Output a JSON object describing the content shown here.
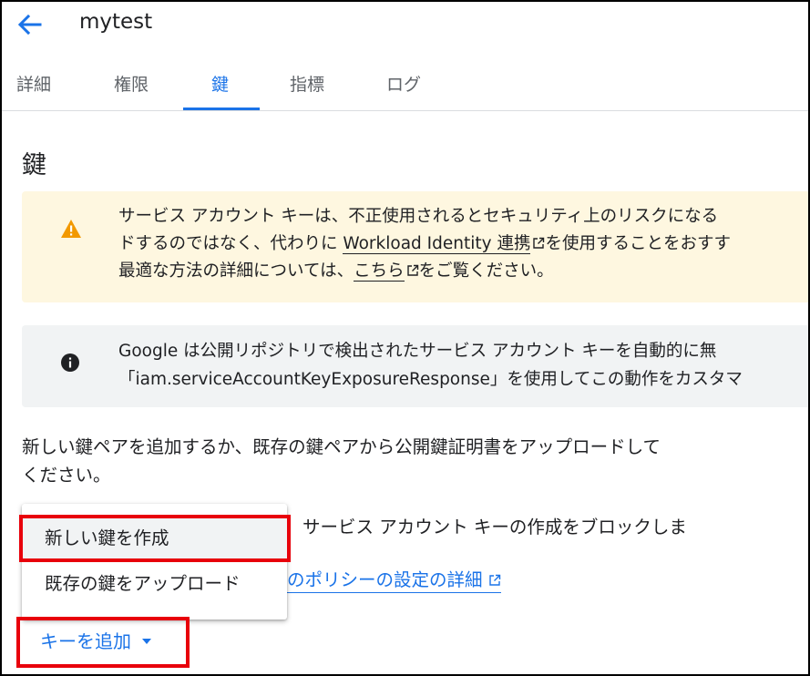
{
  "header": {
    "title": "mytest",
    "back_icon": "arrow-back-icon"
  },
  "tabs": [
    {
      "label": "詳細"
    },
    {
      "label": "権限"
    },
    {
      "label": "鍵"
    },
    {
      "label": "指標"
    },
    {
      "label": "ログ"
    }
  ],
  "active_tab": "鍵",
  "section": {
    "title": "鍵"
  },
  "warning": {
    "icon": "warning-icon",
    "line1": "サービス アカウント キーは、不正使用されるとセキュリティ上のリスクになる",
    "line2_pre": "ドするのではなく、代わりに ",
    "line2_link": "Workload Identity 連携",
    "line2_post": "を使用することをおすす",
    "line3_pre": "最適な方法の詳細については、",
    "line3_link": "こちら",
    "line3_post": "をご覧ください。"
  },
  "info": {
    "icon": "info-icon",
    "line1": "Google は公開リポジトリで検出されたサービス アカウント キーを自動的に無",
    "line2": "「iam.serviceAccountKeyExposureResponse」を使用してこの動作をカスタマ"
  },
  "description": {
    "line1": "新しい鍵ペアを追加するか、既存の鍵ペアから公開鍵証明書をアップロードして",
    "line2": "ください。"
  },
  "policy": {
    "text": "サービス アカウント キーの作成をブロックしま",
    "link": "のポリシーの設定の詳細"
  },
  "menu": {
    "items": [
      {
        "label": "新しい鍵を作成"
      },
      {
        "label": "既存の鍵をアップロード"
      }
    ]
  },
  "add_key_button": {
    "label": "キーを追加"
  },
  "colors": {
    "accent": "#1a73e8",
    "warning_bg": "#fef7e0",
    "warning_icon": "#f29900",
    "info_bg": "#f1f3f4",
    "highlight": "#e8000b"
  }
}
